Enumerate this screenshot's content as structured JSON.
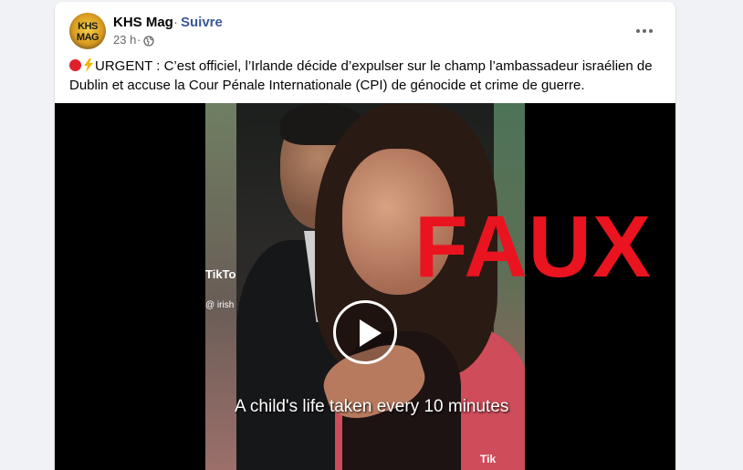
{
  "post": {
    "author": "KHS Mag",
    "separator": "·",
    "follow_label": "Suivre",
    "time": "23 h",
    "time_dot": "·",
    "audience_icon": "globe-icon",
    "more_icon": "more-dots-icon",
    "avatar_text": "KHS MAG",
    "text": "URGENT : C’est officiel, l’Irlande décide d’expulser sur le champ l’ambassadeur israélien de Dublin et accuse la Cour Pénale Internationale (CPI) de génocide et crime de guerre."
  },
  "video": {
    "caption": "A child's life taken every 10 minutes",
    "tiktok_label": "TikTo",
    "tiktok_handle": "@ irish",
    "tiktok_label_corner": "Tik",
    "overlay_stamp": "FAUX",
    "play_icon": "play-icon"
  },
  "colors": {
    "stamp": "#e9141f",
    "follow_link": "#385898"
  }
}
